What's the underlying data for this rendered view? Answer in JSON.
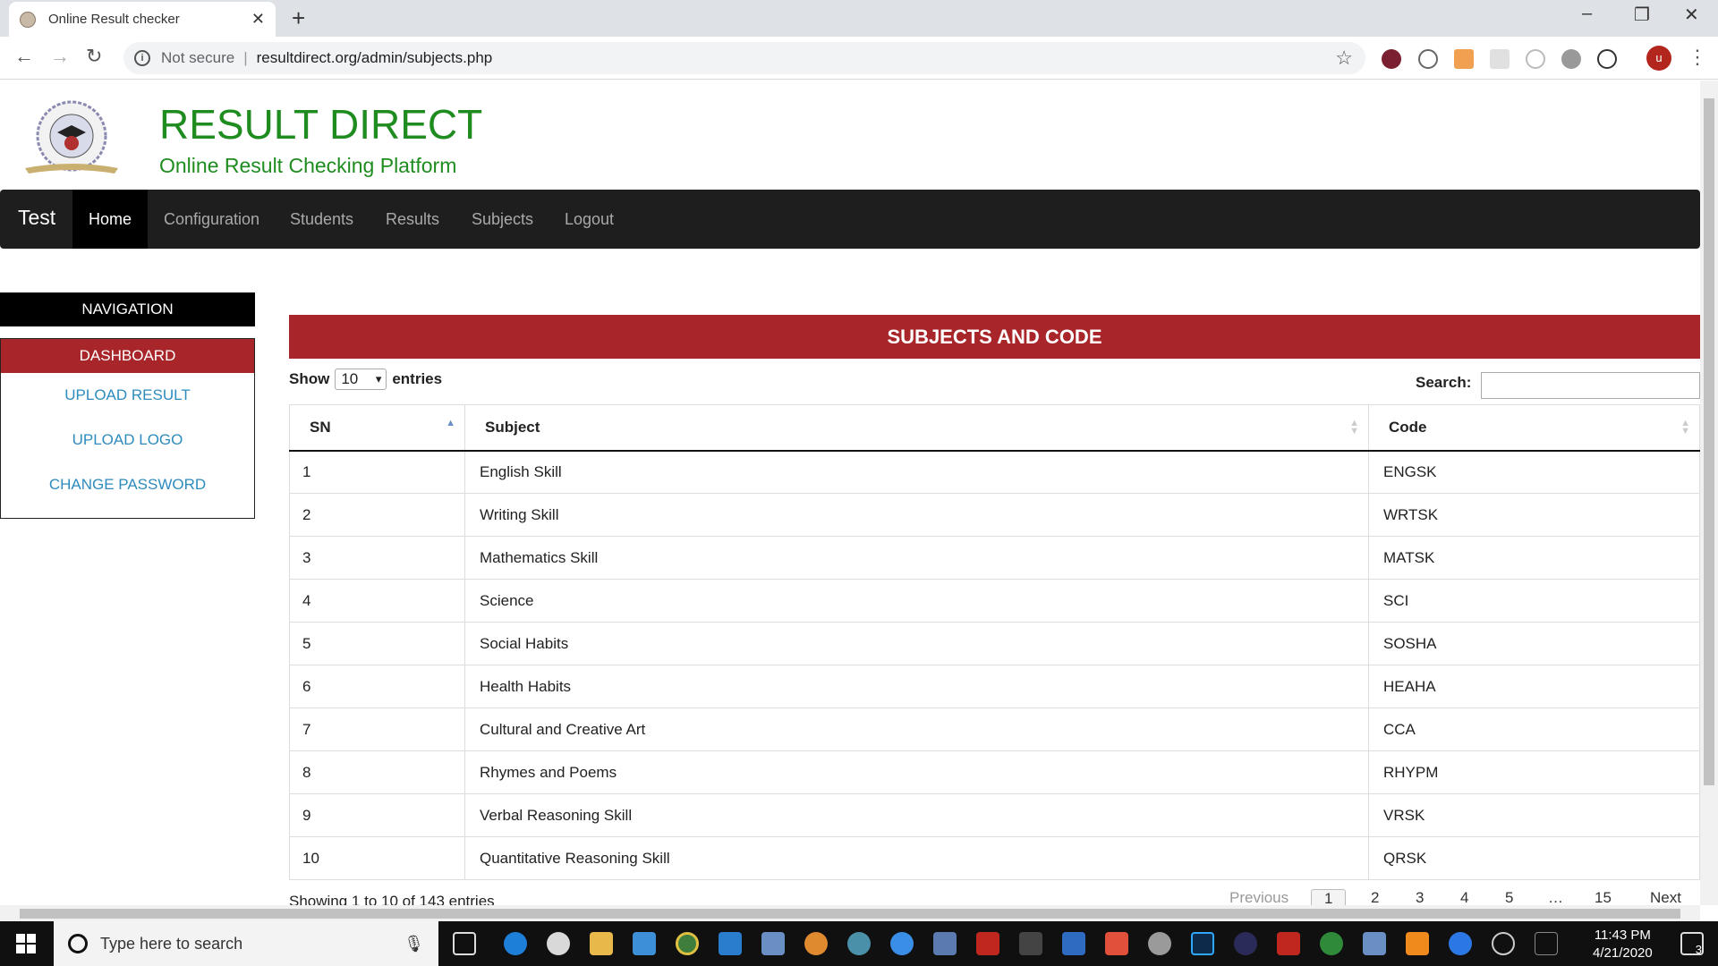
{
  "browser": {
    "tab_title": "Online Result checker",
    "not_secure": "Not secure",
    "url": "resultdirect.org/admin/subjects.php",
    "avatar_letter": "u"
  },
  "site": {
    "title": "RESULT DIRECT",
    "subtitle": "Online Result Checking Platform"
  },
  "nav": {
    "brand": "Test",
    "items": [
      "Home",
      "Configuration",
      "Students",
      "Results",
      "Subjects",
      "Logout"
    ]
  },
  "sidebar": {
    "heading": "NAVIGATION",
    "active": "DASHBOARD",
    "links": [
      "UPLOAD RESULT",
      "UPLOAD LOGO",
      "CHANGE PASSWORD"
    ]
  },
  "panel": {
    "title": "SUBJECTS AND CODE",
    "show_label": "Show",
    "page_size": "10",
    "entries_label": "entries",
    "search_label": "Search:",
    "search_value": ""
  },
  "table": {
    "headers": [
      "SN",
      "Subject",
      "Code"
    ],
    "rows": [
      [
        "1",
        "English Skill",
        "ENGSK"
      ],
      [
        "2",
        "Writing Skill",
        "WRTSK"
      ],
      [
        "3",
        "Mathematics Skill",
        "MATSK"
      ],
      [
        "4",
        "Science",
        "SCI"
      ],
      [
        "5",
        "Social Habits",
        "SOSHA"
      ],
      [
        "6",
        "Health Habits",
        "HEAHA"
      ],
      [
        "7",
        "Cultural and Creative Art",
        "CCA"
      ],
      [
        "8",
        "Rhymes and Poems",
        "RHYPM"
      ],
      [
        "9",
        "Verbal Reasoning Skill",
        "VRSK"
      ],
      [
        "10",
        "Quantitative Reasoning Skill",
        "QRSK"
      ]
    ]
  },
  "footer": {
    "info": "Showing 1 to 10 of 143 entries",
    "previous": "Previous",
    "pages": [
      "1",
      "2",
      "3",
      "4",
      "5",
      "15"
    ],
    "ellipsis": "…",
    "next": "Next"
  },
  "taskbar": {
    "search_placeholder": "Type here to search",
    "time": "11:43 PM",
    "date": "4/21/2020",
    "notifications": "3"
  }
}
